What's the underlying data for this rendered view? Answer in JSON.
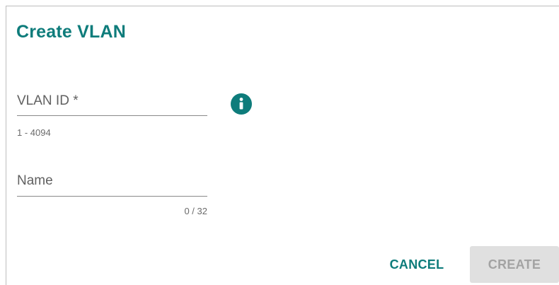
{
  "dialog": {
    "title": "Create VLAN"
  },
  "fields": {
    "vlan_id": {
      "label": "VLAN ID *",
      "value": "",
      "hint": "1 - 4094"
    },
    "name": {
      "label": "Name",
      "value": "",
      "counter": "0 / 32"
    }
  },
  "icons": {
    "info": "info-icon"
  },
  "colors": {
    "accent": "#0e7c7b",
    "disabled_bg": "#e0e0e0",
    "disabled_text": "#a3a3a3"
  },
  "actions": {
    "cancel_label": "CANCEL",
    "create_label": "CREATE"
  }
}
